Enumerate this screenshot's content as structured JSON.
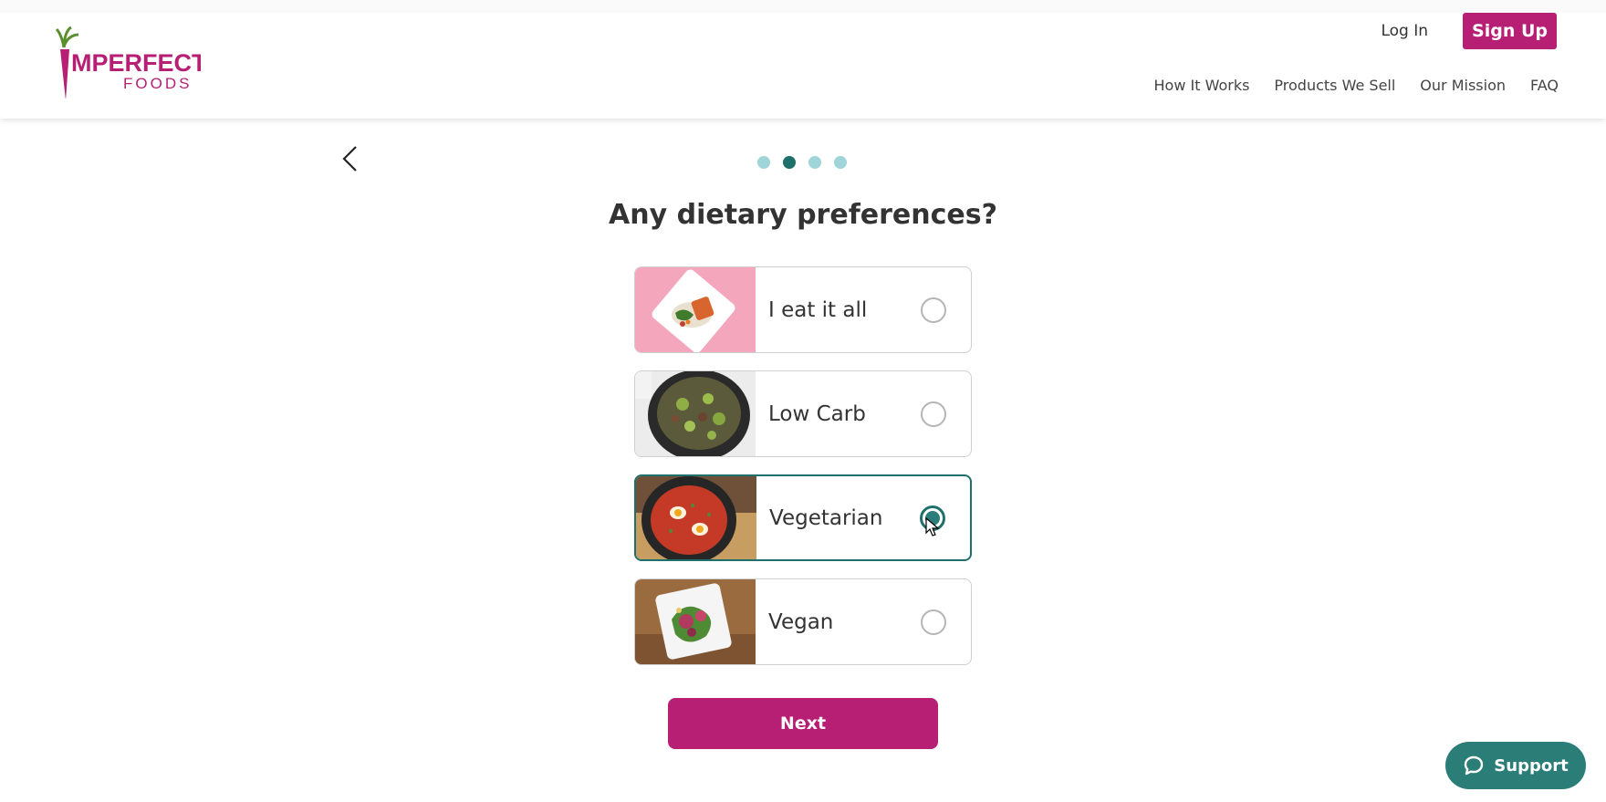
{
  "brand": {
    "logo_line1": "IMPERFECT",
    "logo_line2": "FOODS",
    "logo_color": "#b71f75"
  },
  "header": {
    "login_label": "Log In",
    "signup_label": "Sign Up",
    "nav": [
      "How It Works",
      "Products We Sell",
      "Our Mission",
      "FAQ"
    ]
  },
  "progress": {
    "current_step": 2,
    "total_steps": 4
  },
  "question": "Any dietary preferences?",
  "options": [
    {
      "label": "I eat it all",
      "selected": false,
      "image": "salmon-plate-pink"
    },
    {
      "label": "Low Carb",
      "selected": false,
      "image": "skillet-brussels-sprouts"
    },
    {
      "label": "Vegetarian",
      "selected": true,
      "image": "shakshuka-skillet"
    },
    {
      "label": "Vegan",
      "selected": false,
      "image": "salad-plate-wood"
    }
  ],
  "next_label": "Next",
  "support_label": "Support",
  "colors": {
    "brand_magenta": "#b71f75",
    "teal": "#2b7d78",
    "dot_inactive": "#9fd5d9",
    "dot_active": "#1f6f6a"
  }
}
